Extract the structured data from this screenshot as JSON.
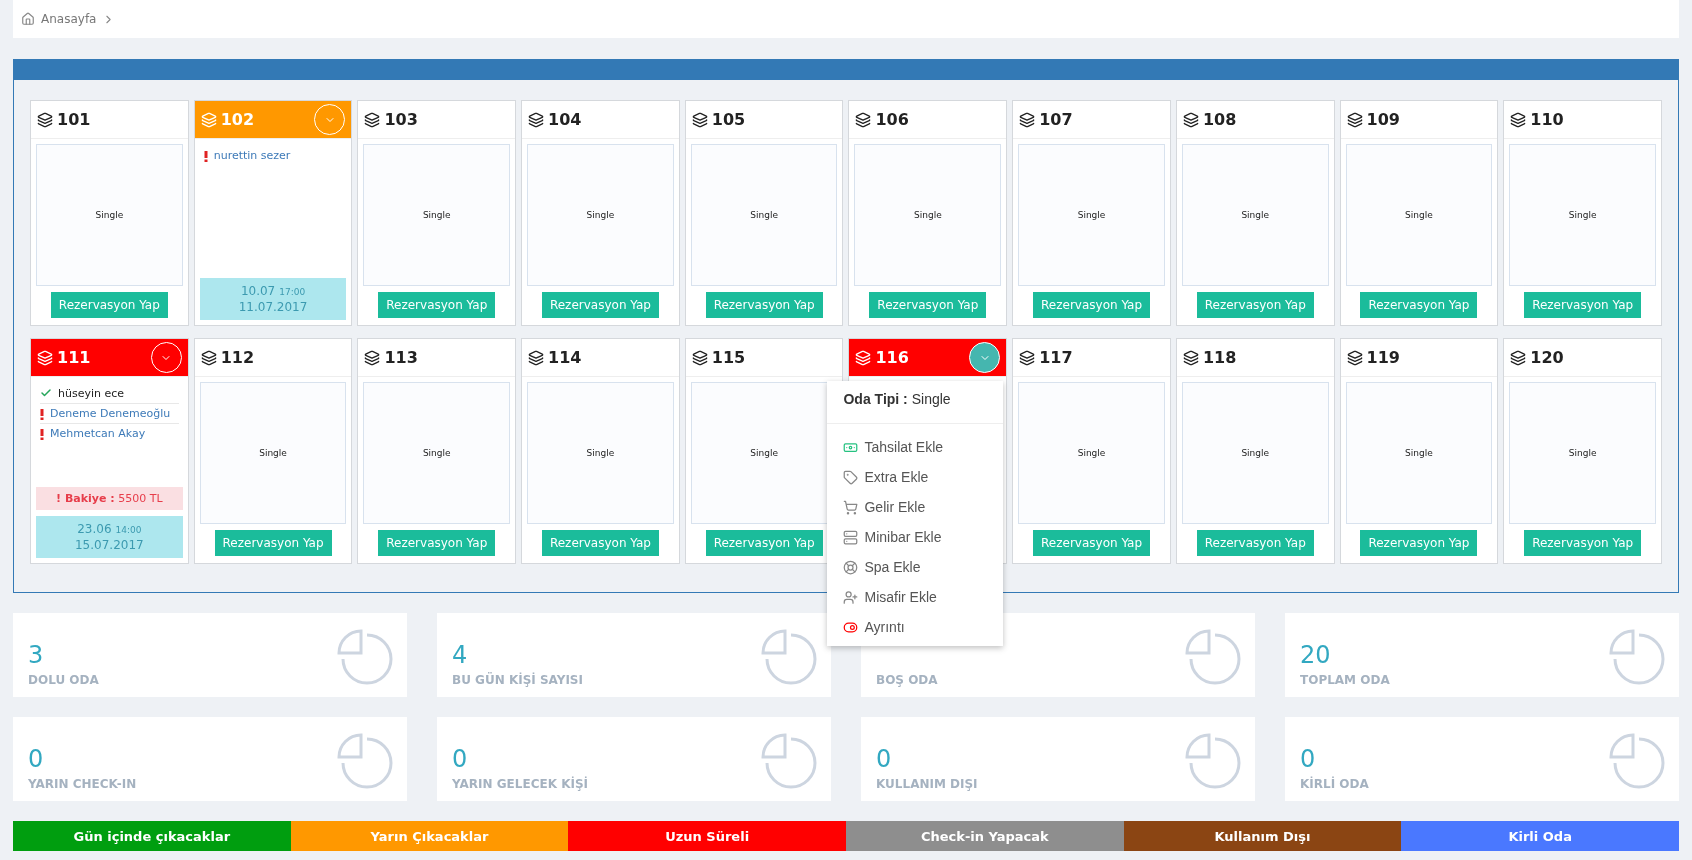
{
  "breadcrumb": {
    "home": "Anasayfa"
  },
  "rooms": [
    {
      "number": "101",
      "kind": "empty",
      "room_type": "Single",
      "button": "Rezervasyon Yap"
    },
    {
      "number": "102",
      "kind": "occupied",
      "color": "#ff9800",
      "menu_open": false,
      "guests": [
        {
          "name": "nurettin sezer",
          "checked_in": false
        }
      ],
      "arrival": "10.07",
      "time": "17:00",
      "departure": "11.07.2017"
    },
    {
      "number": "103",
      "kind": "empty",
      "room_type": "Single",
      "button": "Rezervasyon Yap"
    },
    {
      "number": "104",
      "kind": "empty",
      "room_type": "Single",
      "button": "Rezervasyon Yap"
    },
    {
      "number": "105",
      "kind": "empty",
      "room_type": "Single",
      "button": "Rezervasyon Yap"
    },
    {
      "number": "106",
      "kind": "empty",
      "room_type": "Single",
      "button": "Rezervasyon Yap"
    },
    {
      "number": "107",
      "kind": "empty",
      "room_type": "Single",
      "button": "Rezervasyon Yap"
    },
    {
      "number": "108",
      "kind": "empty",
      "room_type": "Single",
      "button": "Rezervasyon Yap"
    },
    {
      "number": "109",
      "kind": "empty",
      "room_type": "Single",
      "button": "Rezervasyon Yap"
    },
    {
      "number": "110",
      "kind": "empty",
      "room_type": "Single",
      "button": "Rezervasyon Yap"
    },
    {
      "number": "111",
      "kind": "occupied",
      "color": "#ff0000",
      "menu_open": false,
      "guests": [
        {
          "name": "hüseyin ece",
          "checked_in": true
        },
        {
          "name": "Deneme Denemeoğlu",
          "checked_in": false
        },
        {
          "name": "Mehmetcan Akay",
          "checked_in": false
        }
      ],
      "balance": "**! Bakiye :** 5500 TL",
      "arrival": "23.06",
      "time": "14:00",
      "departure": "15.07.2017"
    },
    {
      "number": "112",
      "kind": "empty",
      "room_type": "Single",
      "button": "Rezervasyon Yap"
    },
    {
      "number": "113",
      "kind": "empty",
      "room_type": "Single",
      "button": "Rezervasyon Yap"
    },
    {
      "number": "114",
      "kind": "empty",
      "room_type": "Single",
      "button": "Rezervasyon Yap"
    },
    {
      "number": "115",
      "kind": "empty",
      "room_type": "Single",
      "button": "Rezervasyon Yap"
    },
    {
      "number": "116",
      "kind": "occupied",
      "color": "#ff0000",
      "menu_open": true
    },
    {
      "number": "117",
      "kind": "empty",
      "room_type": "Single",
      "button": "Rezervasyon Yap"
    },
    {
      "number": "118",
      "kind": "empty",
      "room_type": "Single",
      "button": "Rezervasyon Yap"
    },
    {
      "number": "119",
      "kind": "empty",
      "room_type": "Single",
      "button": "Rezervasyon Yap"
    },
    {
      "number": "120",
      "kind": "empty",
      "room_type": "Single",
      "button": "Rezervasyon Yap"
    }
  ],
  "room_menu": {
    "type_label": "Oda Tipi :",
    "type_value": "Single",
    "items": [
      {
        "kind": "money",
        "label": "Tahsilat Ekle"
      },
      {
        "kind": "tag",
        "label": "Extra Ekle"
      },
      {
        "kind": "cart",
        "label": "Gelir Ekle"
      },
      {
        "kind": "list",
        "label": "Minibar Ekle"
      },
      {
        "kind": "lifebuoy",
        "label": "Spa Ekle"
      },
      {
        "kind": "user-plus",
        "label": "Misafir Ekle"
      },
      {
        "kind": "toggle",
        "label": "Ayrıntı"
      }
    ]
  },
  "stats": [
    {
      "value": "3",
      "label": "DOLU ODA"
    },
    {
      "value": "4",
      "label": "BU GÜN KİŞİ SAYISI"
    },
    {
      "label": "BOŞ ODA"
    },
    {
      "value": "20",
      "label": "TOPLAM ODA"
    },
    {
      "value": "0",
      "label": "YARIN CHECK-IN"
    },
    {
      "value": "0",
      "label": "YARIN GELECEK KİŞİ"
    },
    {
      "value": "0",
      "label": "KULLANIM DIŞI"
    },
    {
      "value": "0",
      "label": "KİRLİ ODA"
    }
  ],
  "legend": [
    {
      "label": "Gün içinde çıkacaklar",
      "color": "#009e0f"
    },
    {
      "label": "Yarın Çıkacaklar",
      "color": "#ff9800"
    },
    {
      "label": "Uzun Süreli",
      "color": "#ff0000"
    },
    {
      "label": "Check-in Yapacak",
      "color": "#8e8e8e"
    },
    {
      "label": "Kullanım Dışı",
      "color": "#8b4513"
    },
    {
      "label": "Kirli Oda",
      "color": "#4a78ff"
    }
  ]
}
